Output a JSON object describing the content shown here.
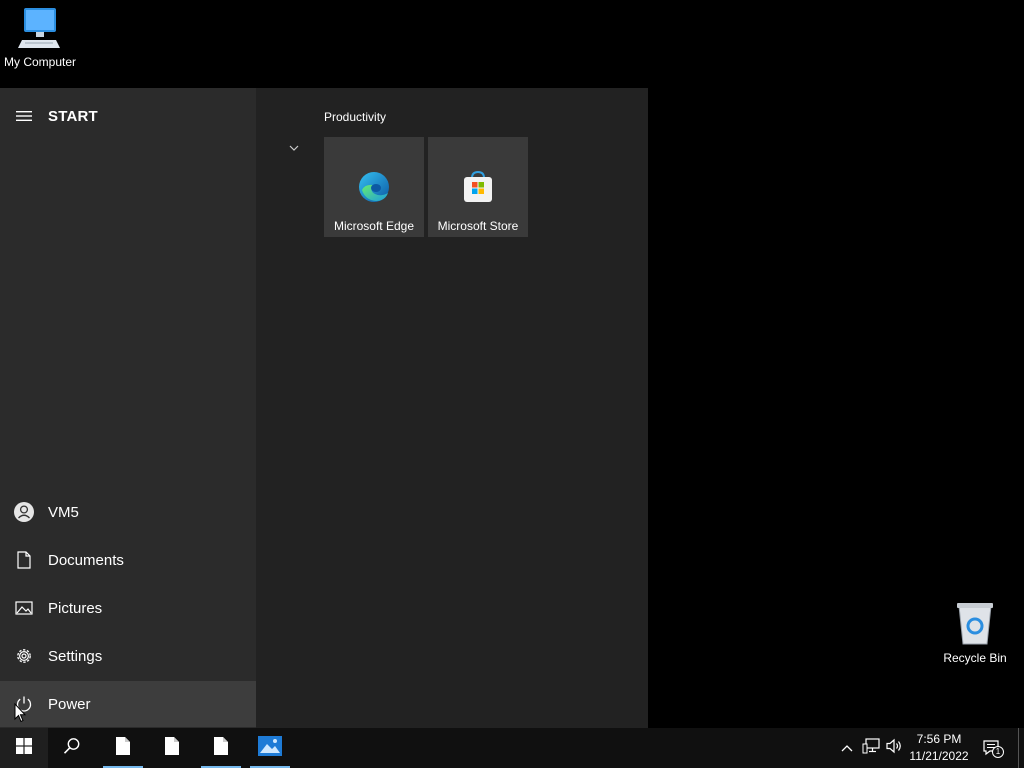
{
  "desktop": {
    "icons": [
      {
        "label": "My Computer",
        "icon": "computer-icon"
      },
      {
        "label": "Recycle Bin",
        "icon": "recycle-bin-icon"
      }
    ]
  },
  "start_menu": {
    "title": "START",
    "user": "VM5",
    "items": [
      {
        "label": "Documents",
        "icon": "document-icon"
      },
      {
        "label": "Pictures",
        "icon": "pictures-icon"
      },
      {
        "label": "Settings",
        "icon": "gear-icon"
      },
      {
        "label": "Power",
        "icon": "power-icon"
      }
    ],
    "group_title": "Productivity",
    "tiles": [
      {
        "label": "Microsoft Edge",
        "icon": "edge-icon"
      },
      {
        "label": "Microsoft Store",
        "icon": "store-icon"
      }
    ]
  },
  "taskbar": {
    "apps": [
      {
        "icon": "file-icon",
        "active": true
      },
      {
        "icon": "file-icon",
        "active": false
      },
      {
        "icon": "file-icon",
        "active": true
      },
      {
        "icon": "photos-icon",
        "active": true
      }
    ],
    "clock": {
      "time": "7:56 PM",
      "date": "11/21/2022"
    },
    "notification_count": "1"
  },
  "colors": {
    "start_left_bg": "#2b2b2b",
    "start_right_bg": "#222222",
    "tile_bg": "#3a3a3a",
    "taskbar_bg": "#101010",
    "accent": "#76b9ed"
  }
}
